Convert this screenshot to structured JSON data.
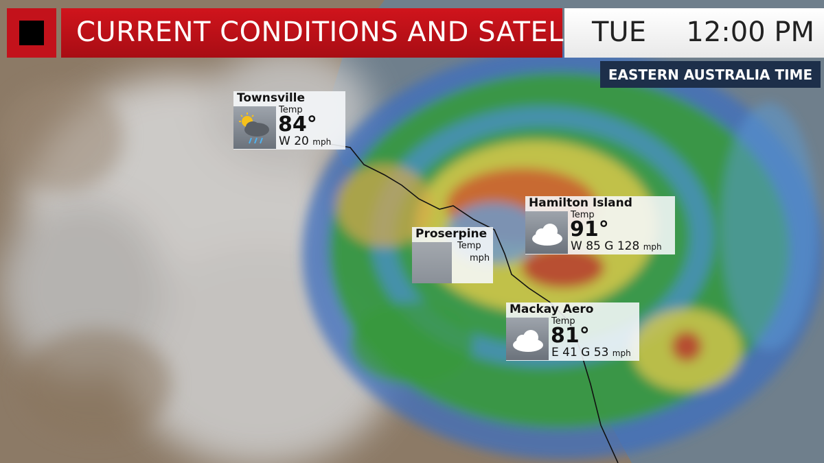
{
  "header": {
    "title": "CURRENT CONDITIONS AND SATELLITE",
    "day": "TUE",
    "time": "12:00 PM",
    "timezone": "EASTERN AUSTRALIA TIME"
  },
  "stations": [
    {
      "name": "Townsville",
      "temp_label": "Temp",
      "temp": "84°",
      "wind": "W 20",
      "unit": "mph",
      "icon": "sun-cloud-rain-icon"
    },
    {
      "name": "Hamilton Island",
      "temp_label": "Temp",
      "temp": "91°",
      "wind": "W 85 G 128",
      "unit": "mph",
      "icon": "cloud-icon"
    },
    {
      "name": "Proserpine",
      "temp_label": "Temp",
      "temp": "",
      "wind": "",
      "unit": "mph",
      "icon": ""
    },
    {
      "name": "Mackay Aero",
      "temp_label": "Temp",
      "temp": "81°",
      "wind": "E 41 G 53",
      "unit": "mph",
      "icon": "cloud-icon"
    }
  ],
  "colors": {
    "title_red": "#c3121b",
    "timezone_navy": "#1d2f4a",
    "radar_green": "#3a9a3c",
    "radar_yellow": "#d9c84a",
    "radar_red": "#b5322a",
    "radar_blue": "#3d6fbf"
  }
}
